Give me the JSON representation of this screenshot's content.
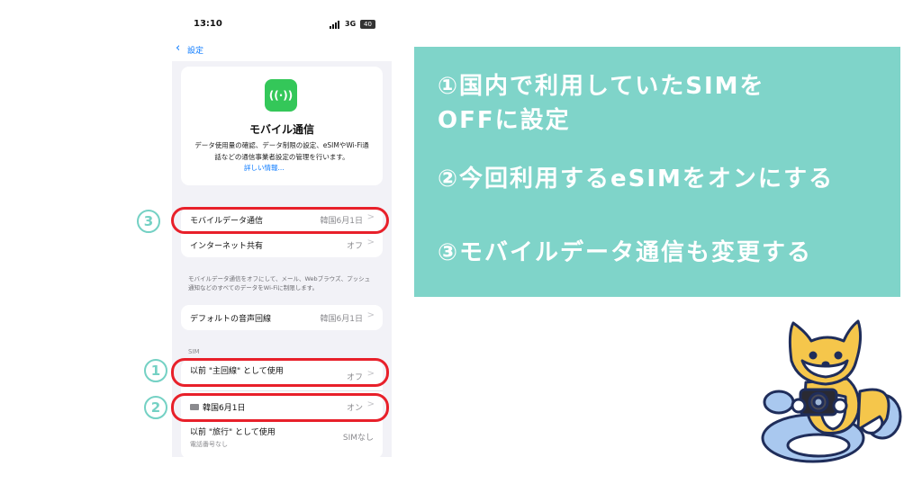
{
  "status_bar": {
    "time": "13:10",
    "network": "3G",
    "battery": "40"
  },
  "nav": {
    "back_label": "設定"
  },
  "hero": {
    "icon_glyph": "((·))",
    "title": "モバイル通信",
    "description": "データ使用量の確認、データ制限の設定、eSIMやWi-Fi通話などの通信事業者設定の管理を行います。",
    "link": "詳しい情報..."
  },
  "rows": {
    "mobile_data": {
      "label": "モバイルデータ通信",
      "value": "韓国6月1日"
    },
    "hotspot": {
      "label": "インターネット共有",
      "value": "オフ"
    },
    "note": "モバイルデータ通信をオフにして、メール、Webブラウズ、プッシュ通知などのすべてのデータをWi-Fiに制限します。",
    "default_voice": {
      "label": "デフォルトの音声回線",
      "value": "韓国6月1日"
    },
    "sim_section": "SIM",
    "sim_primary": {
      "label": "以前 \"主回線\" として使用",
      "value": "オフ"
    },
    "sim_korea": {
      "label": "韓国6月1日",
      "value": "オン"
    },
    "sim_travel": {
      "label": "以前 \"旅行\" として使用",
      "sub": "電話番号なし",
      "value": "SIMなし"
    }
  },
  "badges": {
    "one": "1",
    "two": "2",
    "three": "3"
  },
  "steps": [
    "①国内で利用していたSIMを",
    "OFFに設定",
    "②今回利用するeSIMをオンにする",
    "③モバイルデータ通信も変更する"
  ],
  "colors": {
    "accent_teal": "#7fd4c9",
    "highlight_red": "#e8202a",
    "ios_blue": "#0a7aff",
    "ios_green": "#34c759"
  },
  "chevron": ">"
}
